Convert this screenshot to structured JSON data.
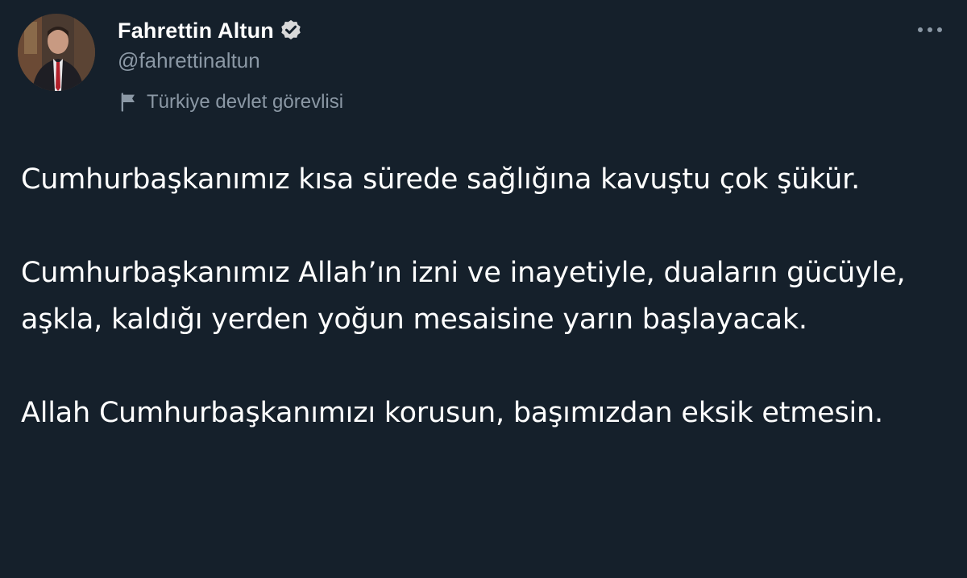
{
  "tweet": {
    "author": {
      "display_name": "Fahrettin Altun",
      "handle": "@fahrettinaltun",
      "verified": true,
      "affiliation": "Türkiye devlet görevlisi",
      "affiliation_icon": "flag-icon"
    },
    "more_icon": "ellipsis-icon",
    "paragraphs": [
      "Cumhurbaşkanımız kısa sürede sağlığına kavuştu çok şükür.",
      "Cumhurbaşkanımız Allah’ın izni ve inayetiyle, duaların gücüyle, aşkla, kaldığı yerden yoğun mesaisine yarın başlayacak.",
      "Allah Cumhurbaşkanımızı korusun, başımızdan eksik etmesin."
    ]
  },
  "theme": {
    "background": "#15202b",
    "text_primary": "#ffffff",
    "text_secondary": "#8b98a5"
  }
}
